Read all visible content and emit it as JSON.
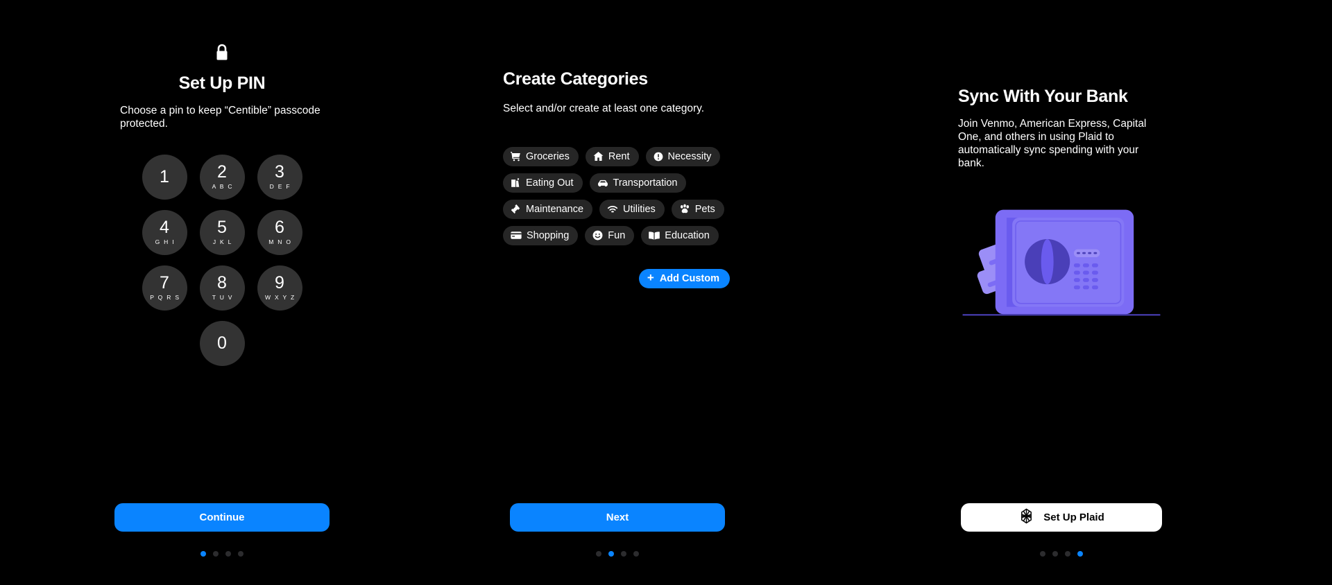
{
  "theme": {
    "background": "#000000",
    "accent_blue": "#0a84ff",
    "chip_bg": "#262626",
    "key_bg": "#333333",
    "dot_inactive": "#2c2c2e",
    "illustration_purple": "#7c6cf5",
    "illustration_purple_dark": "#5b4fd0"
  },
  "screens": {
    "pin": {
      "icon": "lock-icon",
      "title": "Set Up PIN",
      "subtitle": "Choose a pin to keep “Centible” passcode protected.",
      "keys": [
        {
          "num": "1",
          "letters": ""
        },
        {
          "num": "2",
          "letters": "A B C"
        },
        {
          "num": "3",
          "letters": "D E F"
        },
        {
          "num": "4",
          "letters": "G H I"
        },
        {
          "num": "5",
          "letters": "J K L"
        },
        {
          "num": "6",
          "letters": "M N O"
        },
        {
          "num": "7",
          "letters": "P Q R S"
        },
        {
          "num": "8",
          "letters": "T U V"
        },
        {
          "num": "9",
          "letters": "W X Y Z"
        },
        {
          "num": "0",
          "letters": ""
        }
      ],
      "cta_label": "Continue",
      "dots": {
        "count": 4,
        "active_index": 0
      }
    },
    "categories": {
      "title": "Create Categories",
      "subtitle": "Select and/or create at least one category.",
      "chip_rows": [
        [
          {
            "label": "Groceries",
            "icon": "shopping-cart-icon"
          },
          {
            "label": "Rent",
            "icon": "home-icon"
          },
          {
            "label": "Necessity",
            "icon": "exclamation-circle-icon"
          }
        ],
        [
          {
            "label": "Eating Out",
            "icon": "takeout-bag-icon"
          },
          {
            "label": "Transportation",
            "icon": "car-icon"
          }
        ],
        [
          {
            "label": "Maintenance",
            "icon": "hammer-icon"
          },
          {
            "label": "Utilities",
            "icon": "wifi-icon"
          },
          {
            "label": "Pets",
            "icon": "paw-icon"
          }
        ],
        [
          {
            "label": "Shopping",
            "icon": "credit-card-icon"
          },
          {
            "label": "Fun",
            "icon": "smiley-face-icon"
          },
          {
            "label": "Education",
            "icon": "book-icon"
          }
        ]
      ],
      "add_custom_label": "Add Custom",
      "add_custom_icon": "plus-icon",
      "cta_label": "Next",
      "dots": {
        "count": 4,
        "active_index": 1
      }
    },
    "bank": {
      "title": "Sync With Your Bank",
      "subtitle": "Join Venmo, American Express, Capital One, and others in using Plaid to automatically sync spending with your bank.",
      "illustration": "bank-vault-illustration",
      "cta_label": "Set Up Plaid",
      "cta_icon": "plaid-logo-icon",
      "dots": {
        "count": 4,
        "active_index": 3
      }
    }
  }
}
